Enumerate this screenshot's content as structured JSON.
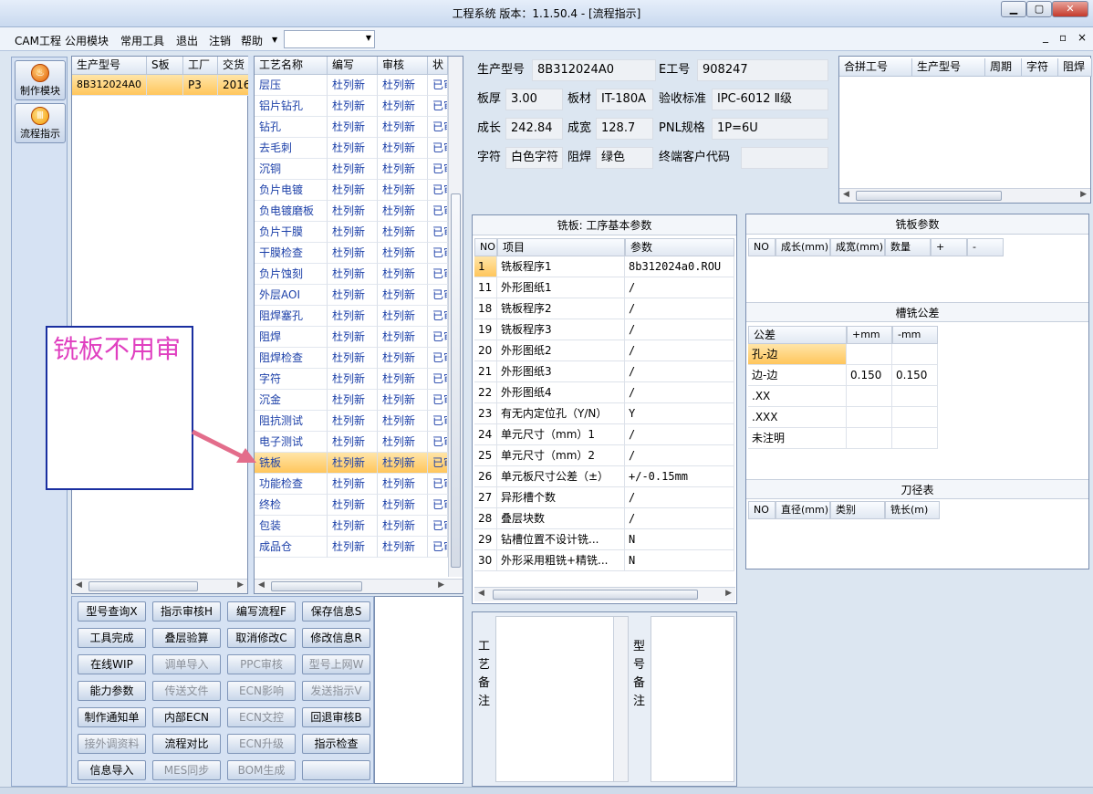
{
  "window": {
    "title": "工程系统   版本：1.1.50.4 - [流程指示]",
    "minimize": "▁",
    "restore": "▢",
    "close": "✕"
  },
  "menu": {
    "items": [
      "CAM工程",
      "公用模块",
      "常用工具",
      "退出",
      "注销",
      "帮助"
    ],
    "right_controls": [
      "_",
      "▫",
      "×"
    ]
  },
  "nav": {
    "items": [
      {
        "label": "制作模块",
        "icon": "fire-icon"
      },
      {
        "label": "流程指示",
        "icon": "flow-icon"
      }
    ]
  },
  "model_list": {
    "headers": [
      "生产型号",
      "S板",
      "工厂",
      "交货"
    ],
    "rows": [
      [
        "8B312024A0",
        "",
        "P3",
        "2016"
      ]
    ]
  },
  "process_list": {
    "headers": [
      "工艺名称",
      "编写",
      "审核",
      "状"
    ],
    "rows": [
      [
        "层压",
        "杜列新",
        "杜列新",
        "已审"
      ],
      [
        "铝片钻孔",
        "杜列新",
        "杜列新",
        "已审"
      ],
      [
        "钻孔",
        "杜列新",
        "杜列新",
        "已审"
      ],
      [
        "去毛刺",
        "杜列新",
        "杜列新",
        "已审"
      ],
      [
        "沉铜",
        "杜列新",
        "杜列新",
        "已审"
      ],
      [
        "负片电镀",
        "杜列新",
        "杜列新",
        "已审"
      ],
      [
        "负电镀磨板",
        "杜列新",
        "杜列新",
        "已审"
      ],
      [
        "负片干膜",
        "杜列新",
        "杜列新",
        "已审"
      ],
      [
        "干膜检查",
        "杜列新",
        "杜列新",
        "已审"
      ],
      [
        "负片蚀刻",
        "杜列新",
        "杜列新",
        "已审"
      ],
      [
        "外层AOI",
        "杜列新",
        "杜列新",
        "已审"
      ],
      [
        "阻焊塞孔",
        "杜列新",
        "杜列新",
        "已审"
      ],
      [
        "阻焊",
        "杜列新",
        "杜列新",
        "已审"
      ],
      [
        "阻焊检查",
        "杜列新",
        "杜列新",
        "已审"
      ],
      [
        "字符",
        "杜列新",
        "杜列新",
        "已审"
      ],
      [
        "沉金",
        "杜列新",
        "杜列新",
        "已审"
      ],
      [
        "阻抗测试",
        "杜列新",
        "杜列新",
        "已审"
      ],
      [
        "电子测试",
        "杜列新",
        "杜列新",
        "已审"
      ],
      [
        "铣板",
        "杜列新",
        "杜列新",
        "已审"
      ],
      [
        "功能检查",
        "杜列新",
        "杜列新",
        "已审"
      ],
      [
        "终检",
        "杜列新",
        "杜列新",
        "已审"
      ],
      [
        "包装",
        "杜列新",
        "杜列新",
        "已审"
      ],
      [
        "成品仓",
        "杜列新",
        "杜列新",
        "已审"
      ]
    ],
    "selected_index": 18
  },
  "annotation": {
    "text": "铣板不用审"
  },
  "actions": {
    "rows": [
      [
        {
          "label": "型号查询X",
          "enabled": true
        },
        {
          "label": "指示审核H",
          "enabled": true
        },
        {
          "label": "编写流程F",
          "enabled": true
        },
        {
          "label": "保存信息S",
          "enabled": true
        }
      ],
      [
        {
          "label": "工具完成",
          "enabled": true
        },
        {
          "label": "叠层验算",
          "enabled": true
        },
        {
          "label": "取消修改C",
          "enabled": true
        },
        {
          "label": "修改信息R",
          "enabled": true
        }
      ],
      [
        {
          "label": "在线WIP",
          "enabled": true
        },
        {
          "label": "调单导入",
          "enabled": false
        },
        {
          "label": "PPC审核",
          "enabled": false
        },
        {
          "label": "型号上网W",
          "enabled": false
        }
      ],
      [
        {
          "label": "能力参数",
          "enabled": true
        },
        {
          "label": "传送文件",
          "enabled": false
        },
        {
          "label": "ECN影响",
          "enabled": false
        },
        {
          "label": "发送指示V",
          "enabled": false
        }
      ],
      [
        {
          "label": "制作通知单",
          "enabled": true
        },
        {
          "label": "内部ECN",
          "enabled": true
        },
        {
          "label": "ECN文控",
          "enabled": false
        },
        {
          "label": "回退审核B",
          "enabled": true
        }
      ],
      [
        {
          "label": "接外调资料",
          "enabled": false
        },
        {
          "label": "流程对比",
          "enabled": true
        },
        {
          "label": "ECN升级",
          "enabled": false
        },
        {
          "label": "指示检查",
          "enabled": true
        }
      ],
      [
        {
          "label": "信息导入",
          "enabled": true
        },
        {
          "label": "MES同步",
          "enabled": false
        },
        {
          "label": "BOM生成",
          "enabled": false
        },
        {
          "label": "",
          "enabled": true
        }
      ]
    ]
  },
  "info": {
    "model_label": "生产型号",
    "model_value": "8B312024A0",
    "eng_label": "E工号",
    "eng_value": "908247",
    "thickness_label": "板厚",
    "thickness_value": "3.00",
    "material_label": "板材",
    "material_value": "IT-180A",
    "standard_label": "验收标准",
    "standard_value": "IPC-6012 Ⅱ级",
    "length_label": "成长",
    "length_value": "242.84",
    "width_label": "成宽",
    "width_value": "128.7",
    "pnl_label": "PNL规格",
    "pnl_value": "1P=6U",
    "char_label": "字符",
    "char_value": "白色字符",
    "mask_label": "阻焊",
    "mask_value": "绿色",
    "customer_label": "终端客户代码",
    "customer_value": ""
  },
  "combine": {
    "headers": [
      "合拼工号",
      "生产型号",
      "周期",
      "字符",
      "阻焊"
    ]
  },
  "params": {
    "title": "铣板: 工序基本参数",
    "headers": [
      "NO",
      "项目",
      "参数"
    ],
    "rows": [
      [
        "1",
        "铣板程序1",
        "8b312024a0.ROU"
      ],
      [
        "11",
        "外形图纸1",
        "/"
      ],
      [
        "18",
        "铣板程序2",
        "/"
      ],
      [
        "19",
        "铣板程序3",
        "/"
      ],
      [
        "20",
        "外形图纸2",
        "/"
      ],
      [
        "21",
        "外形图纸3",
        "/"
      ],
      [
        "22",
        "外形图纸4",
        "/"
      ],
      [
        "23",
        "有无内定位孔（Y/N）",
        "Y"
      ],
      [
        "24",
        "单元尺寸（mm）1",
        "/"
      ],
      [
        "25",
        "单元尺寸（mm）2",
        "/"
      ],
      [
        "26",
        "单元板尺寸公差（±）",
        "+/-0.15mm"
      ],
      [
        "27",
        "异形槽个数",
        "/"
      ],
      [
        "28",
        "叠层块数",
        "/"
      ],
      [
        "29",
        "钻槽位置不设计铣...",
        "N"
      ],
      [
        "30",
        "外形采用粗铣+精铣...",
        "N"
      ]
    ]
  },
  "mill_params": {
    "title": "铣板参数",
    "headers": [
      "NO",
      "成长(mm)",
      "成宽(mm)",
      "数量",
      "+",
      "-"
    ]
  },
  "slot_tol": {
    "title": "槽铣公差",
    "headers": [
      "公差",
      "+mm",
      "-mm"
    ],
    "rows": [
      [
        "孔-边",
        "",
        ""
      ],
      [
        "边-边",
        "0.150",
        "0.150"
      ],
      [
        ".XX",
        "",
        ""
      ],
      [
        ".XXX",
        "",
        ""
      ],
      [
        "未注明",
        "",
        ""
      ]
    ]
  },
  "tool_table": {
    "title": "刀径表",
    "headers": [
      "NO",
      "直径(mm)",
      "类别",
      "铣长(m)"
    ]
  },
  "notes": {
    "process_label": "工艺备注",
    "model_label": "型号备注"
  }
}
